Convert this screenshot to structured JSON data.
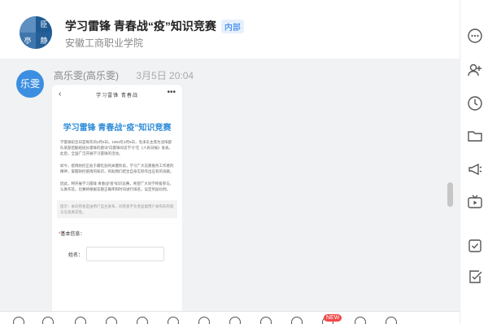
{
  "window": {
    "minimize": "—",
    "close": "✕"
  },
  "group": {
    "avatar_chars": [
      "臣",
      "",
      "亭",
      "静"
    ],
    "title": "学习雷锋 青春战“疫”知识竞赛",
    "badge": "内部",
    "subtitle": "安徽工商职业学院"
  },
  "message": {
    "avatar_text": "乐雯",
    "sender": "高乐雯(高乐雯)",
    "time": "3月5日  20:04",
    "card": {
      "back": "‹",
      "nav_title": "学习雷锋 青春战",
      "more": "•••",
      "heading": "学习雷锋 青春战“疫”知识竞赛",
      "para1": "学雷锋纪念日是每年的3月5日。1963年3月5日，毛泽东主席为沈阳部队某部后勤班班长雷锋的题词“向雷锋同志学习”在《人民日报》发表。此后，全国广泛开展学习雷锋的活动。",
      "para2": "如今，疫情防控正处于最吃劲的关键阶段，学习广大志愿服务工作者的精神，掌握防控疫情的知识，有助我们结合自身实际作出应有的贡献。",
      "para3": "因此，特开展学习雷锋 青春战“疫”知识竞赛，希望广大同学积极参与，认真作答。比赛将根据答题正确率和时间进行排名，设定奖励比例。",
      "note": "提示：本问卷星是由用户自主发布，问卷星不负责监督用户发布的内容与信息真实性。",
      "form_title": "基本信息：",
      "form_required": "*",
      "field_label": "姓名："
    }
  },
  "toolbar": {
    "new_badge": "NEW"
  },
  "colors": {
    "accent": "#2f8cd8",
    "chat_bg": "#f1f2f4",
    "avatar": "#3c8fe0"
  }
}
